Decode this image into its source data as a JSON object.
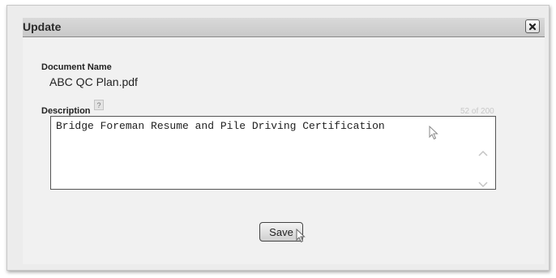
{
  "dialog": {
    "title": "Update",
    "close_icon": "close-icon"
  },
  "document": {
    "label": "Document Name",
    "value": "ABC QC Plan.pdf"
  },
  "description": {
    "label": "Description",
    "help_glyph": "?",
    "char_count": "52 of 200",
    "value": "Bridge Foreman Resume and Pile Driving Certification"
  },
  "actions": {
    "save_label": "Save"
  },
  "colors": {
    "title_bar": "#cfcfcf",
    "panel": "#f1f1f1",
    "counter_text": "#c8c8c8"
  }
}
